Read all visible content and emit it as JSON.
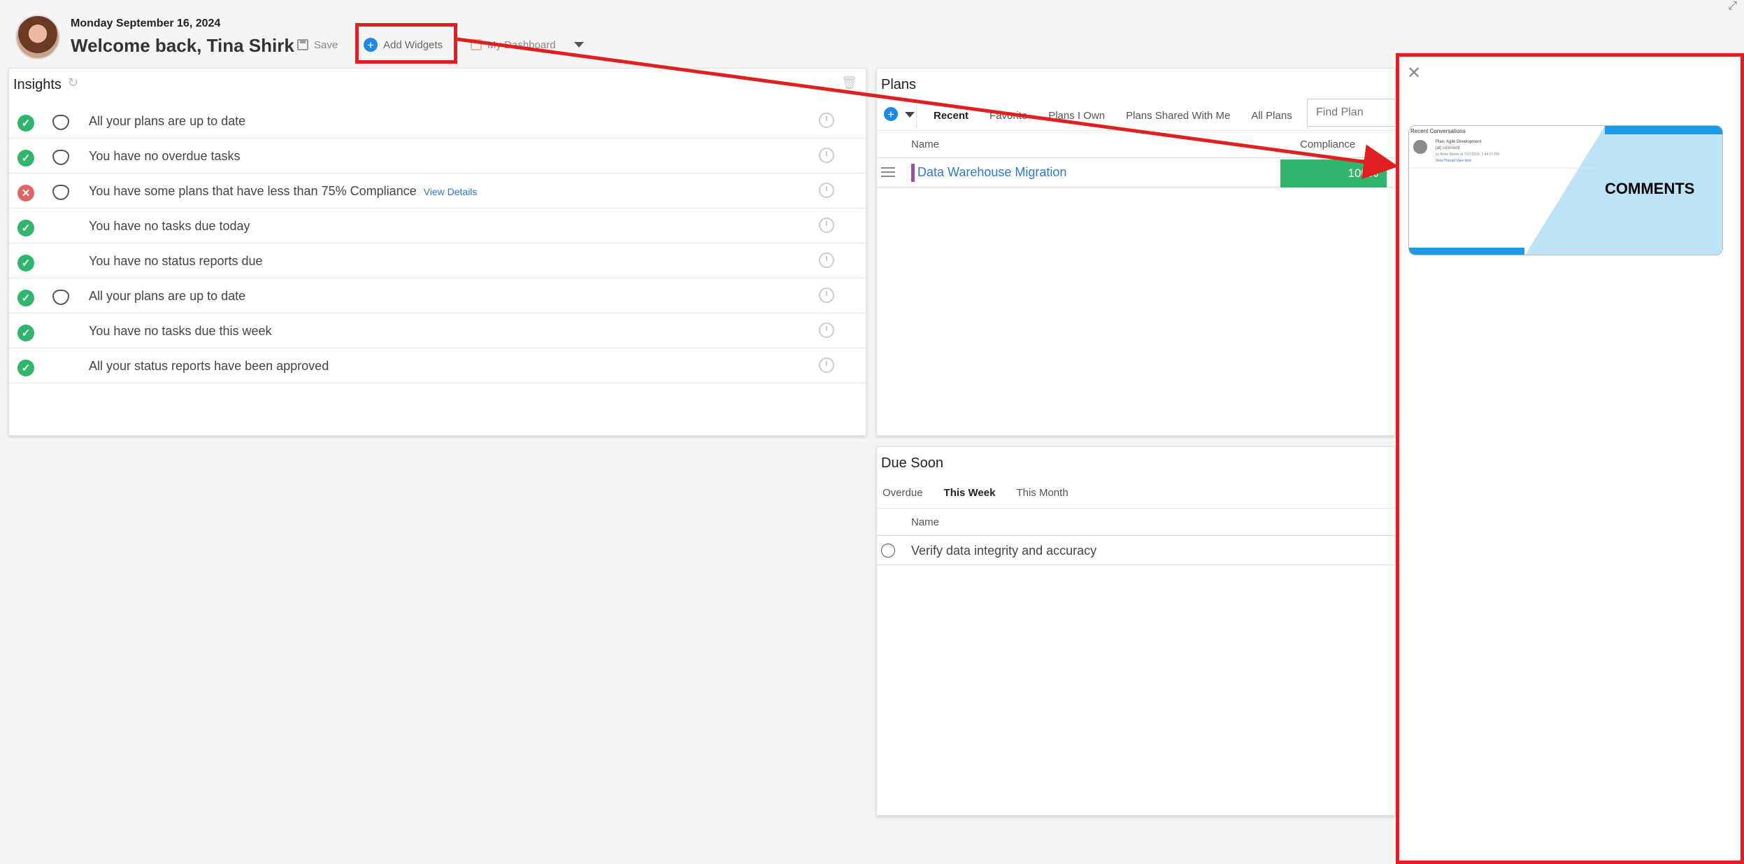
{
  "header": {
    "date": "Monday September 16, 2024",
    "welcome": "Welcome back, Tina Shirk",
    "save_label": "Save",
    "add_widgets_label": "Add Widgets",
    "dashboard_label": "My Dashboard"
  },
  "insights": {
    "title": "Insights",
    "rows": [
      {
        "status": "ok",
        "shield": true,
        "text": "All your plans are up to date"
      },
      {
        "status": "ok",
        "shield": true,
        "text": "You have no overdue tasks"
      },
      {
        "status": "bad",
        "shield": true,
        "text": "You have some plans that have less than 75% Compliance",
        "link": "View Details"
      },
      {
        "status": "ok",
        "shield": false,
        "text": "You have no tasks due today"
      },
      {
        "status": "ok",
        "shield": false,
        "text": "You have no status reports due"
      },
      {
        "status": "ok",
        "shield": true,
        "text": "All your plans are up to date"
      },
      {
        "status": "ok",
        "shield": false,
        "text": "You have no tasks due this week"
      },
      {
        "status": "ok",
        "shield": false,
        "text": "All your status reports have been approved"
      }
    ]
  },
  "plans": {
    "title": "Plans",
    "tabs": [
      "Recent",
      "Favorite",
      "Plans I Own",
      "Plans Shared With Me",
      "All Plans"
    ],
    "find_placeholder": "Find Plan",
    "columns": {
      "name": "Name",
      "compliance": "Compliance"
    },
    "rows": [
      {
        "name": "Data Warehouse Migration",
        "compliance": "100%",
        "accent_color": "#9b4fb5"
      }
    ]
  },
  "due_soon": {
    "title": "Due Soon",
    "tabs": [
      "Overdue",
      "This Week",
      "This Month"
    ],
    "columns": {
      "name": "Name"
    },
    "rows": [
      {
        "name": "Verify data integrity and accuracy"
      }
    ]
  },
  "widget_panel": {
    "preview": {
      "recent_title": "Recent Conversations",
      "line1": "Plan: Agile Development",
      "line2": "[at] comment",
      "line3": "by Brian Martin at 7/17/2024, 1:44:07 PM",
      "line4": "View Thread    View Item",
      "label": "COMMENTS"
    }
  },
  "colors": {
    "accent_blue": "#1e88e5",
    "success_green": "#2fb66c",
    "error_red": "#e06666",
    "annotation_red": "#e02020",
    "link_blue": "#2e78c8"
  }
}
